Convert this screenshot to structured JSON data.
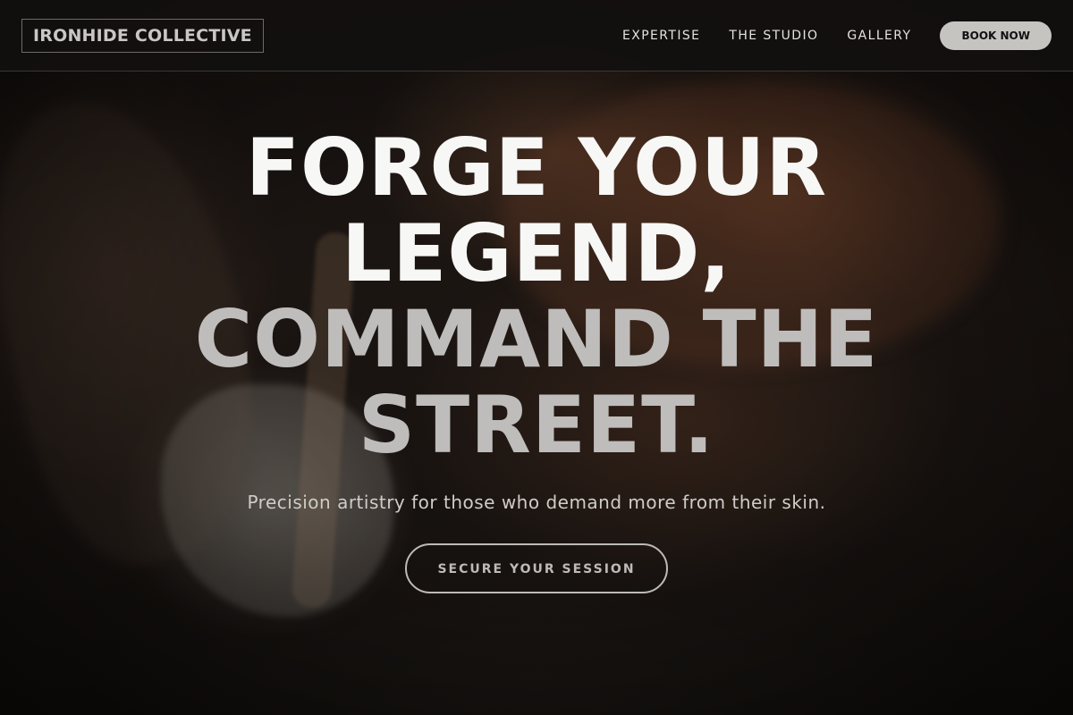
{
  "brand": {
    "logo_text": "IRONHIDE COLLECTIVE"
  },
  "nav": {
    "items": [
      {
        "label": "EXPERTISE"
      },
      {
        "label": "THE STUDIO"
      },
      {
        "label": "GALLERY"
      }
    ],
    "book_label": "BOOK NOW"
  },
  "hero": {
    "title_lines": [
      "FORGE YOUR",
      "LEGEND,",
      "COMMAND THE",
      "STREET."
    ],
    "subtitle": "Precision artistry for those who demand more from their skin.",
    "cta_label": "SECURE YOUR SESSION"
  },
  "colors": {
    "header_bg": "#121010",
    "accent_button": "#c6c4c1",
    "title_light": "#f7f7f6",
    "title_dim": "#bfbdbb"
  }
}
